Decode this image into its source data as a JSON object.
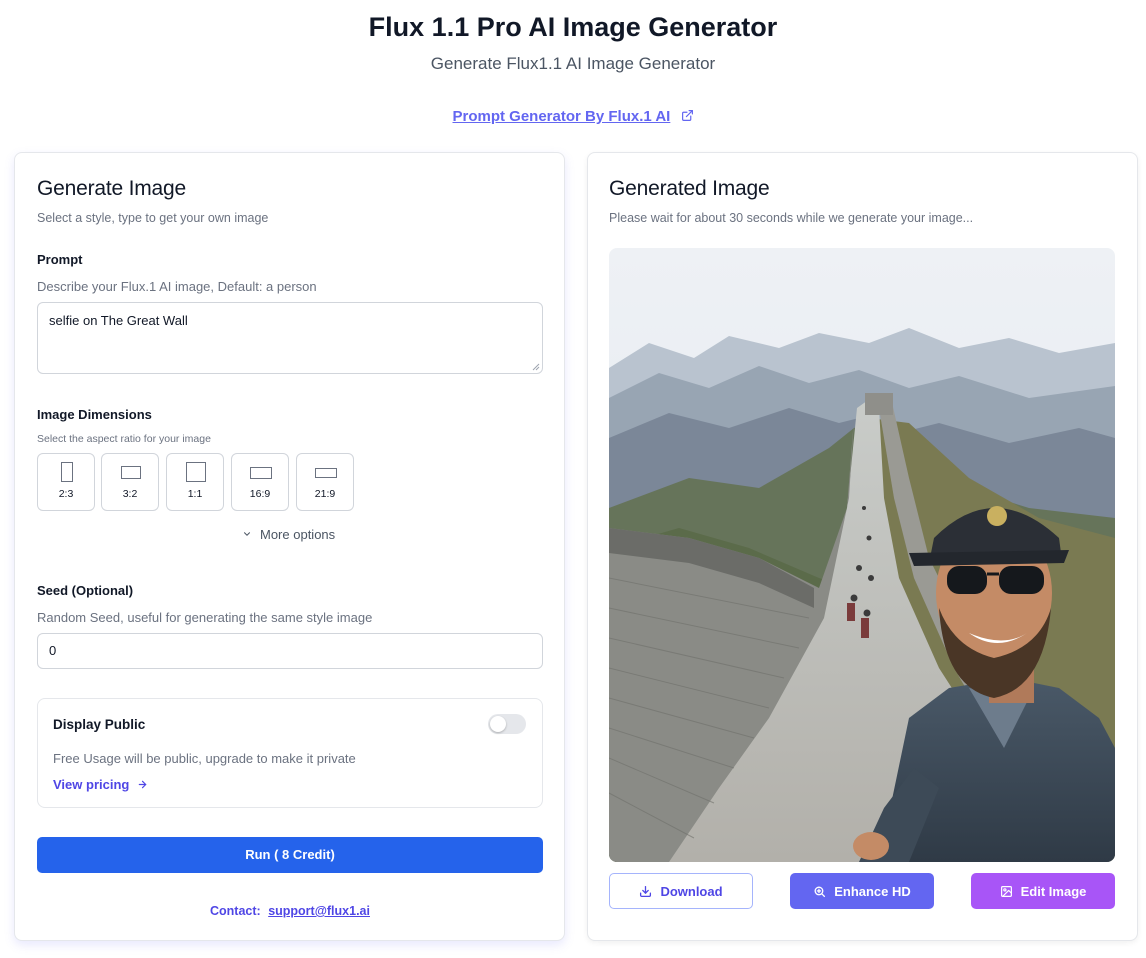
{
  "header": {
    "title": "Flux 1.1 Pro AI Image Generator",
    "subtitle": "Generate Flux1.1 AI Image Generator",
    "prompt_link": "Prompt Generator By Flux.1 AI"
  },
  "left_card": {
    "title": "Generate Image",
    "description": "Select a style, type to get your own image",
    "prompt": {
      "label": "Prompt",
      "help": "Describe your Flux.1 AI image, Default: a person",
      "value": "selfie on The Great Wall"
    },
    "dimensions": {
      "label": "Image Dimensions",
      "help": "Select the aspect ratio for your image",
      "ratios": [
        "2:3",
        "3:2",
        "1:1",
        "16:9",
        "21:9"
      ],
      "more_options": "More options"
    },
    "seed": {
      "label": "Seed (Optional)",
      "help": "Random Seed, useful for generating the same style image",
      "value": "0"
    },
    "public": {
      "label": "Display Public",
      "enabled": false,
      "help": "Free Usage will be public, upgrade to make it private",
      "pricing_link": "View pricing"
    },
    "run_button": "Run   ( 8 Credit)",
    "contact": {
      "label": "Contact:",
      "email": "support@flux1.ai"
    }
  },
  "right_card": {
    "title": "Generated Image",
    "description": "Please wait for about 30 seconds while we generate your image...",
    "actions": {
      "download": "Download",
      "enhance": "Enhance HD",
      "edit": "Edit Image"
    }
  },
  "colors": {
    "primary_blue": "#2563eb",
    "indigo": "#6366f1",
    "purple": "#a855f7",
    "link": "#4f46e5"
  },
  "icons": [
    "external-link-icon",
    "chevron-down-icon",
    "arrow-right-icon",
    "download-icon",
    "zoom-in-icon",
    "edit-image-icon"
  ]
}
